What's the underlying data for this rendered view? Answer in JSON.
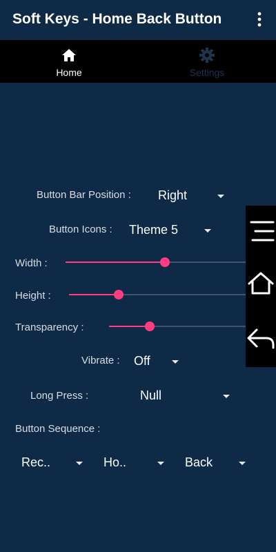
{
  "app": {
    "title": "Soft Keys - Home Back Button"
  },
  "tabs": [
    {
      "label": "Home",
      "icon": "home-icon",
      "active": true
    },
    {
      "label": "Settings",
      "icon": "gear-icon",
      "active": false
    }
  ],
  "settings": {
    "bar_position": {
      "label": "Button Bar Position :",
      "value": "Right"
    },
    "button_icons": {
      "label": "Button Icons :",
      "value": "Theme 5"
    },
    "width": {
      "label": "Width :",
      "level": 0.55
    },
    "height": {
      "label": "Height :",
      "level": 0.28
    },
    "transparency": {
      "label": "Transparency :",
      "level": 0.3
    },
    "vibrate": {
      "label": "Vibrate :",
      "value": "Off"
    },
    "long_press": {
      "label": "Long Press :",
      "value": "Null"
    },
    "button_sequence": {
      "label": "Button Sequence :",
      "values": [
        "Rec..",
        "Ho..",
        "Back"
      ]
    }
  },
  "softkeys": [
    "menu-icon",
    "home-icon",
    "back-icon"
  ],
  "colors": {
    "background": "#0e2a47",
    "accent": "#ff3d7f",
    "tabbar": "#000000"
  }
}
